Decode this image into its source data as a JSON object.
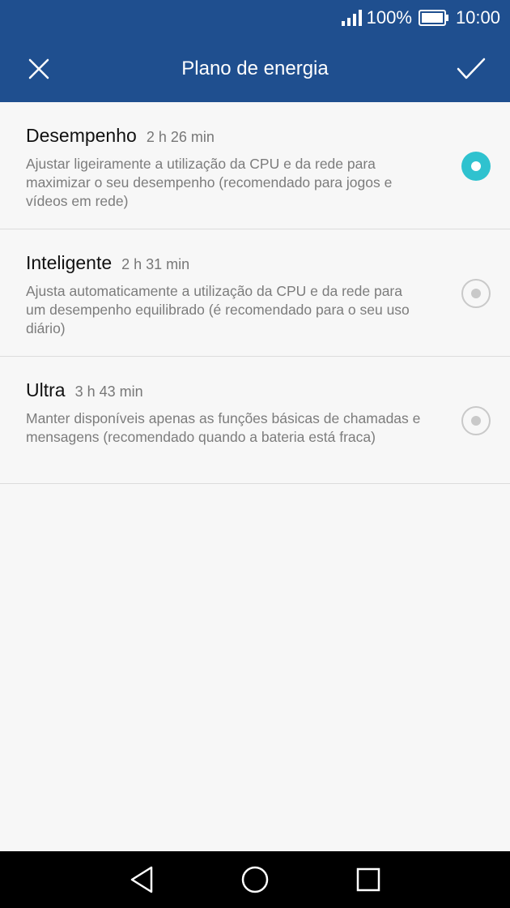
{
  "status_bar": {
    "battery": "100%",
    "time": "10:00"
  },
  "app_bar": {
    "title": "Plano de energia"
  },
  "options": [
    {
      "name": "Desempenho",
      "time": "2 h 26 min",
      "description": "Ajustar ligeiramente a utilização da CPU e da rede para maximizar o seu desempenho (recomendado para jogos e vídeos em rede)",
      "selected": true
    },
    {
      "name": "Inteligente",
      "time": "2 h 31 min",
      "description": "Ajusta automaticamente a utilização da CPU e da rede para um desempenho equilibrado (é recomendado para o seu uso diário)",
      "selected": false
    },
    {
      "name": "Ultra",
      "time": "3 h 43 min",
      "description": "Manter disponíveis apenas as funções básicas de chamadas e mensagens (recomendado quando a bateria está fraca)",
      "selected": false
    }
  ],
  "colors": {
    "header": "#1f4f8f",
    "accent": "#2fc2cf",
    "nav": "#000000"
  },
  "icons": [
    "signal-icon",
    "battery-icon",
    "close-icon",
    "check-icon",
    "back-icon",
    "home-icon",
    "recents-icon"
  ]
}
